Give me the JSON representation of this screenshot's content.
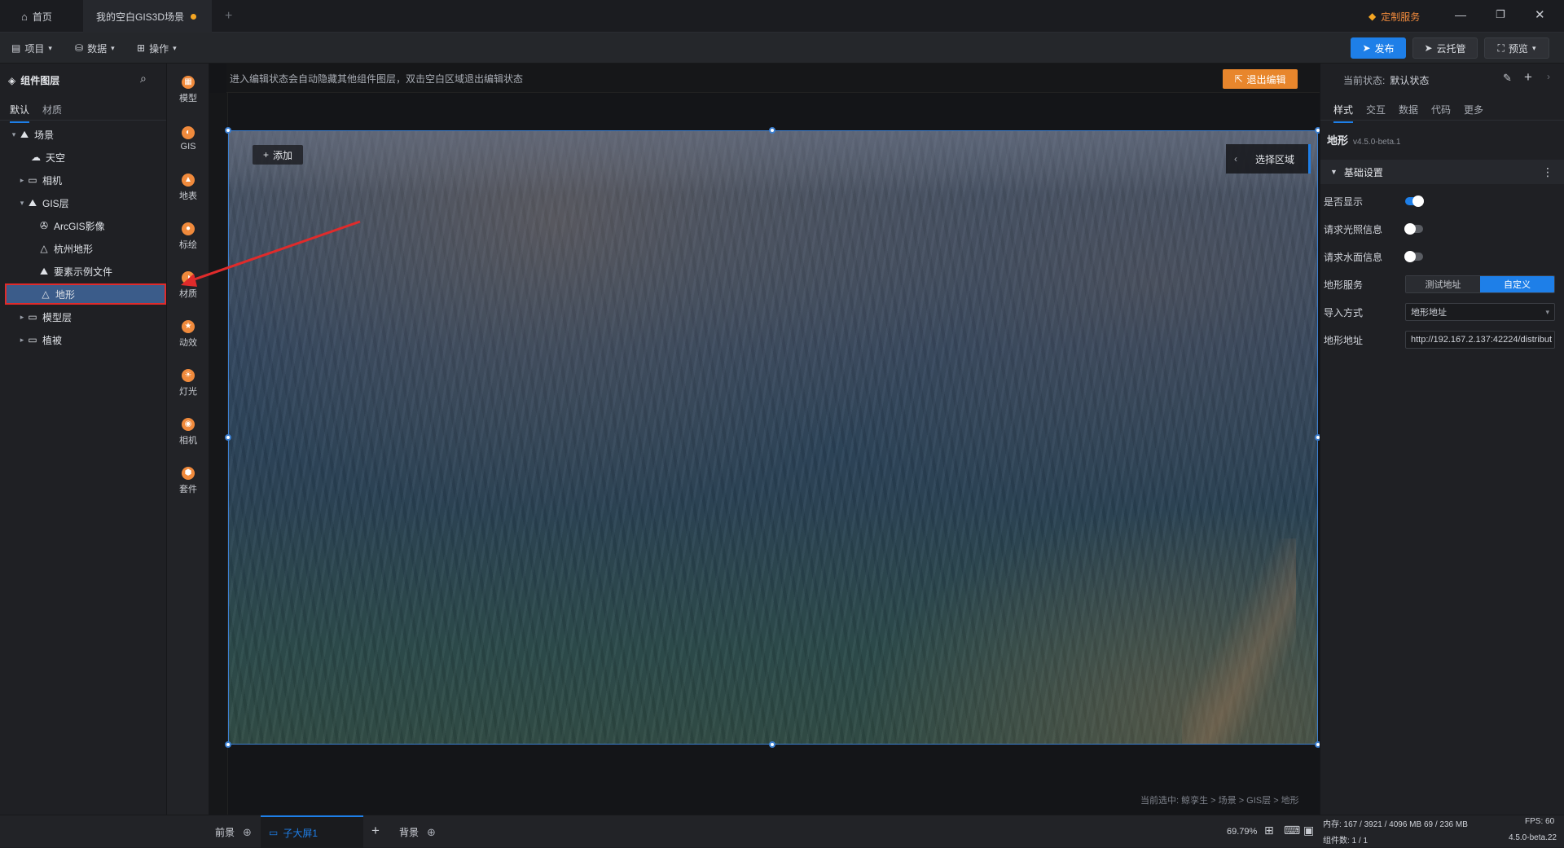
{
  "titlebar": {
    "home_tab": "首页",
    "scene_tab": "我的空白GIS3D场景",
    "custom_service": "定制服务"
  },
  "menubar": {
    "project": "项目",
    "data": "数据",
    "operate": "操作",
    "publish": "发布",
    "cloud_host": "云托管",
    "preview": "预览"
  },
  "left_panel": {
    "title": "组件图层",
    "tabs": [
      "默认",
      "材质"
    ],
    "tree": [
      {
        "label": "场景",
        "icon": "scene-icon"
      },
      {
        "label": "天空",
        "icon": "sky-icon"
      },
      {
        "label": "相机",
        "icon": "folder-icon"
      },
      {
        "label": "GIS层",
        "icon": "gis-layer-icon"
      },
      {
        "label": "ArcGIS影像",
        "icon": "satellite-icon"
      },
      {
        "label": "杭州地形",
        "icon": "terrain-icon"
      },
      {
        "label": "要素示例文件",
        "icon": "feature-icon"
      },
      {
        "label": "地形",
        "icon": "terrain-icon"
      },
      {
        "label": "模型层",
        "icon": "folder-icon"
      },
      {
        "label": "植被",
        "icon": "folder-icon"
      }
    ]
  },
  "toolbar": {
    "items": [
      "模型",
      "GIS",
      "地表",
      "标绘",
      "材质",
      "动效",
      "灯光",
      "相机",
      "套件"
    ]
  },
  "canvas": {
    "hint": "进入编辑状态会自动隐藏其他组件图层，双击空白区域退出编辑状态",
    "exit_edit": "退出编辑",
    "add": "添加",
    "select_area": "选择区域",
    "breadcrumb": "当前选中: 鲸孪生 > 场景 > GIS层 > 地形"
  },
  "right_panel": {
    "current_state_label": "当前状态:",
    "current_state_value": "默认状态",
    "tabs": [
      "样式",
      "交互",
      "数据",
      "代码",
      "更多"
    ],
    "component_name": "地形",
    "version": "v4.5.0-beta.1",
    "section": "基础设置",
    "rows": {
      "show": "是否显示",
      "light_info": "请求光照信息",
      "water_info": "请求水面信息",
      "terrain_service": "地形服务",
      "import_method": "导入方式",
      "terrain_url": "地形地址"
    },
    "service_options": [
      "测试地址",
      "自定义"
    ],
    "import_value": "地形地址",
    "url_value": "http://192.167.2.137:42224/distribut"
  },
  "statusbar": {
    "front": "前景",
    "screen": "子大屏1",
    "background": "背景",
    "zoom": "69.79%",
    "memory": "内存:  167 / 3921 / 4096 MB  69 / 236 MB",
    "fps": "FPS:  60",
    "components": "组件数: 1 / 1",
    "version": "4.5.0-beta.22"
  },
  "colors": {
    "accent": "#1e7fe8",
    "orange": "#e8862c",
    "selected_outline": "#e02b2b"
  }
}
